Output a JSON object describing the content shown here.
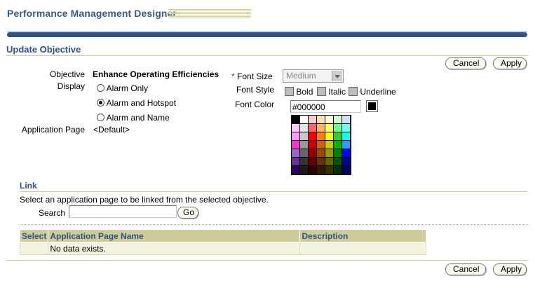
{
  "app": {
    "title": "Performance Management Designer"
  },
  "page": {
    "title": "Update Objective"
  },
  "buttons": {
    "cancel": "Cancel",
    "apply": "Apply",
    "go": "Go"
  },
  "form": {
    "objective_label": "Objective",
    "objective_value": "Enhance Operating Efficiencies",
    "display_label": "Display",
    "display_options": [
      "Alarm Only",
      "Alarm and Hotspot",
      "Alarm and Name"
    ],
    "display_selected": 1,
    "app_page_label": "Application Page",
    "app_page_value": "<Default>",
    "font_size_required": "*",
    "font_size_label": "Font Size",
    "font_size_value": "Medium",
    "font_style_label": "Font Style",
    "font_styles": [
      "Bold",
      "Italic",
      "Underline"
    ],
    "font_color_label": "Font Color",
    "font_color_value": "#000000",
    "font_color_swatch": "#000000"
  },
  "palette": [
    "#000000",
    "#ffffff",
    "#ffcccc",
    "#ffe0b0",
    "#ffffcc",
    "#ccffcc",
    "#cce0ff",
    "#ffccff",
    "#e6e6e6",
    "#ff6666",
    "#ffb366",
    "#ffff66",
    "#66ff99",
    "#66ffff",
    "#ff99ff",
    "#c8c8c8",
    "#ff0000",
    "#ff8000",
    "#ffff00",
    "#33cc33",
    "#00ffff",
    "#ff33cc",
    "#9a9a9a",
    "#cc0000",
    "#cc6600",
    "#cccc00",
    "#00b300",
    "#3399ff",
    "#9966cc",
    "#666666",
    "#990000",
    "#994c00",
    "#999900",
    "#008000",
    "#0000ff",
    "#663399",
    "#333333",
    "#660000",
    "#663300",
    "#666600",
    "#005900",
    "#000099",
    "#330066",
    "#1a1a1a",
    "#330000",
    "#331900",
    "#333300",
    "#003300",
    "#000066"
  ],
  "link": {
    "title": "Link",
    "instructions": "Select an application page to be linked from the selected objective.",
    "search_label": "Search",
    "search_value": "",
    "table": {
      "headers": [
        "Select",
        "Application Page Name",
        "Description"
      ],
      "empty_message": "No data exists."
    }
  }
}
